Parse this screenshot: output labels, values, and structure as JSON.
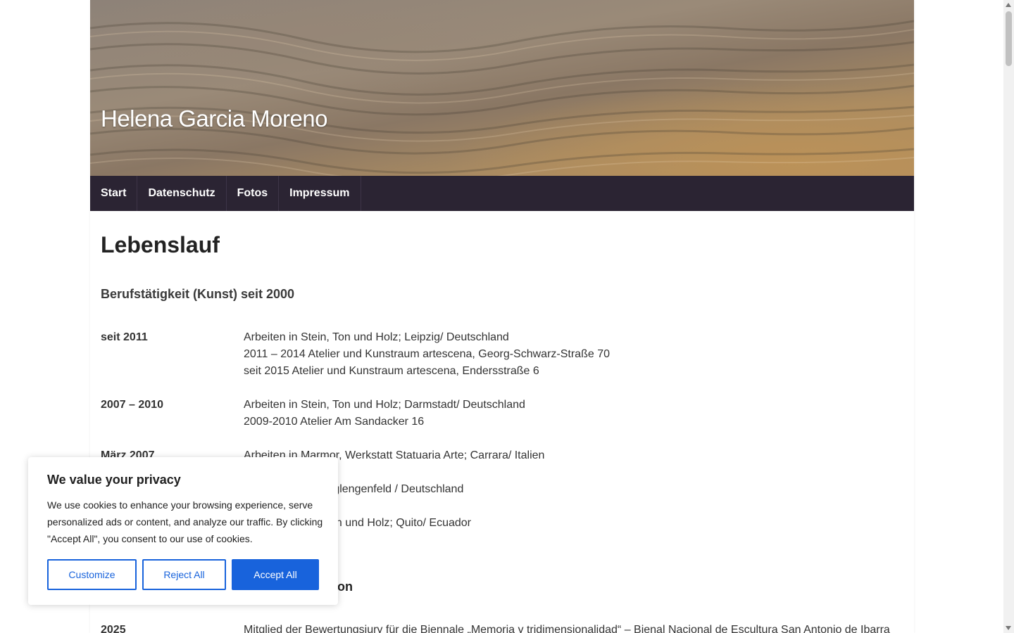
{
  "site": {
    "title": "Helena Garcia Moreno"
  },
  "nav": {
    "items": [
      "Start",
      "Datenschutz",
      "Fotos",
      "Impressum"
    ]
  },
  "content": {
    "page_title": "Lebenslauf",
    "section1_title": "Berufstätigkeit (Kunst) seit 2000",
    "section2_title_visible": "tion",
    "rows": [
      {
        "year": "seit 2011",
        "lines": [
          "Arbeiten in Stein, Ton und Holz; Leipzig/ Deutschland",
          "2011 – 2014 Atelier und Kunstraum artescena, Georg-Schwarz-Straße 70",
          "seit 2015 Atelier und Kunstraum artescena, Endersstraße 6"
        ]
      },
      {
        "year": "2007 – 2010",
        "lines": [
          "Arbeiten in Stein, Ton und Holz; Darmstadt/ Deutschland",
          "2009-2010 Atelier Am Sandacker 16"
        ]
      },
      {
        "year": "März 2007",
        "lines": [
          "Arbeiten in Marmor, Werkstatt Statuaria Arte; Carrara/ Italien"
        ]
      },
      {
        "year": "",
        "lines": [
          "rglengenfeld / Deutschland"
        ]
      },
      {
        "year": "",
        "lines": [
          "on und Holz; Quito/ Ecuador"
        ]
      },
      {
        "year": "2025",
        "lines": [
          "Mitglied der Bewertungsjury für die Biennale „Memoria y tridimensionalidad“ – Bienal Nacional de Escultura San Antonio de Ibarra"
        ]
      }
    ]
  },
  "cookie": {
    "title": "We value your privacy",
    "text": "We use cookies to enhance your browsing experience, serve personalized ads or content, and analyze our traffic. By clicking \"Accept All\", you consent to our use of cookies.",
    "customize": "Customize",
    "reject": "Reject All",
    "accept": "Accept All"
  },
  "colors": {
    "nav_bg": "#2b2433",
    "accent": "#1863dc"
  }
}
